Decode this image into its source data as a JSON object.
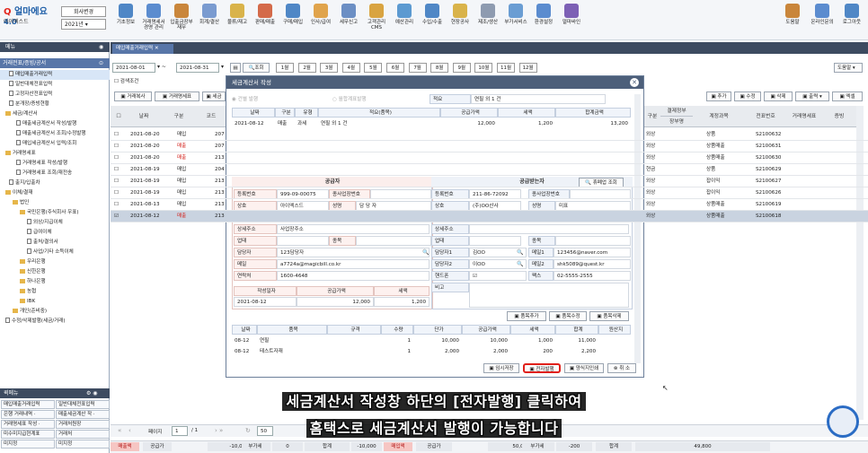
{
  "app": {
    "logo_prefix": "얼마에요",
    "logo_version": "4.0",
    "company": "아이엑스드",
    "company_btn": "회사변경",
    "year": "2021년"
  },
  "toolbar": {
    "left": [
      "기초정보",
      "거래명세서 경영 관리",
      "입출금장부 재무",
      "회계/결산",
      "물류/재고",
      "판매/매출",
      "구매/매입",
      "인사/급여",
      "세무신고",
      "고객관리 CMS",
      "예산관리",
      "수입/수출",
      "현장공사",
      "제조/생산",
      "부가서비스",
      "환경설정",
      "얼마바인"
    ],
    "right": [
      "도움말",
      "온라인문의",
      "로그아웃"
    ],
    "colors": [
      "#4f87c6",
      "#5b8ccf",
      "#c9863b",
      "#7a9bd0",
      "#d9b34a",
      "#d46a4a",
      "#4f87c6",
      "#e0a44c",
      "#6c8fc4",
      "#d9a441",
      "#5c9ad1",
      "#4f87c6",
      "#d9b34a",
      "#8e9bb0",
      "#6a9dd3",
      "#5b8ccf",
      "#7d60b5"
    ]
  },
  "left_panel": {
    "header": "메뉴",
    "subheader": "거래전표/증빙/공서",
    "tree": [
      {
        "label": "매입매출거래입력",
        "type": "doc",
        "indent": 2
      },
      {
        "label": "일반대체전표입력",
        "type": "doc",
        "indent": 2
      },
      {
        "label": "고정자산전표입력",
        "type": "doc",
        "indent": 2
      },
      {
        "label": "분개장/증빙현황",
        "type": "doc",
        "indent": 2
      },
      {
        "label": "세금/계산서",
        "type": "folder",
        "indent": 1
      },
      {
        "label": "매출세금계산서 작성/발행",
        "type": "doc",
        "indent": 4
      },
      {
        "label": "매출세금계산서 조회/수정발행",
        "type": "doc",
        "indent": 4
      },
      {
        "label": "매입세금계산서 입력/조회",
        "type": "doc",
        "indent": 4
      },
      {
        "label": "거래명세표",
        "type": "folder",
        "indent": 1
      },
      {
        "label": "거래명세표 작성/발행",
        "type": "doc",
        "indent": 4
      },
      {
        "label": "거래명세표 조회/재전송",
        "type": "doc",
        "indent": 4
      },
      {
        "label": "출지/입출차",
        "type": "doc",
        "indent": 2
      },
      {
        "label": "이체/결재",
        "type": "folder",
        "indent": 1
      },
      {
        "label": "법인",
        "type": "folder",
        "indent": 3
      },
      {
        "label": "국민은행(주식회사 우표)",
        "type": "folder",
        "indent": 5
      },
      {
        "label": "외상/지급이체",
        "type": "doc",
        "indent": 7
      },
      {
        "label": "급여이체",
        "type": "doc",
        "indent": 7
      },
      {
        "label": "출처/결의서",
        "type": "doc",
        "indent": 7
      },
      {
        "label": "사업/기타 소득이체",
        "type": "doc",
        "indent": 7
      },
      {
        "label": "우리은행",
        "type": "folder",
        "indent": 5
      },
      {
        "label": "신한은행",
        "type": "folder",
        "indent": 5
      },
      {
        "label": "하나은행",
        "type": "folder",
        "indent": 5
      },
      {
        "label": "농협",
        "type": "folder",
        "indent": 5
      },
      {
        "label": "IBK",
        "type": "folder",
        "indent": 5
      },
      {
        "label": "개인(준비중)",
        "type": "folder",
        "indent": 3
      },
      {
        "label": "수정/삭제발행(세금/거래)",
        "type": "doc",
        "indent": 1
      }
    ],
    "quick_header": "퀵메뉴",
    "quick": [
      "매입매출거래입력",
      "일반대체전표입력",
      "은행 거래내역 ·",
      "매출세금계산 작 ·",
      "거래명세표 작성 ·",
      "거래처원장",
      "미수미지급현계표",
      "거래처",
      "미지정",
      "미지정"
    ]
  },
  "main": {
    "tab": "매입매출거래입력",
    "date_from": "2021-08-01",
    "date_to": "2021-08-31",
    "search_btn": "조회",
    "months": [
      "1월",
      "2월",
      "3월",
      "4월",
      "5월",
      "6월",
      "7월",
      "8월",
      "9월",
      "10월",
      "11월",
      "12월"
    ],
    "search_cond": "검색조건",
    "help_select": "도움말",
    "action_left": [
      "거래복사",
      "거래명세표",
      "세금"
    ],
    "action_right": [
      "추가",
      "수정",
      "삭제",
      "출력",
      "엑셀"
    ],
    "headers_left": [
      "날짜",
      "구분",
      "코드"
    ],
    "headers_right": [
      "구분",
      "결제정부",
      "장부명",
      "계정과목",
      "전표번호",
      "거래명세표",
      "증빙"
    ],
    "rows": [
      {
        "date": "2021-08-20",
        "type": "매입",
        "code": "207",
        "pay": "외상",
        "acct": "상품",
        "no": "S2100632"
      },
      {
        "date": "2021-08-20",
        "type": "매출",
        "code": "207",
        "pay": "외상",
        "acct": "상품매출",
        "no": "S2100631"
      },
      {
        "date": "2021-08-20",
        "type": "매출",
        "code": "213",
        "pay": "외상",
        "acct": "상품매출",
        "no": "S2100630"
      },
      {
        "date": "2021-08-19",
        "type": "매입",
        "code": "204",
        "pay": "현금",
        "acct": "상품",
        "no": "S2100629"
      },
      {
        "date": "2021-08-19",
        "type": "매입",
        "code": "213",
        "pay": "외상",
        "acct": "잡이익",
        "no": "S2100627"
      },
      {
        "date": "2021-08-19",
        "type": "매입",
        "code": "213",
        "pay": "외상",
        "acct": "잡이익",
        "no": "S2100626"
      },
      {
        "date": "2021-08-13",
        "type": "매입",
        "code": "213",
        "pay": "외상",
        "acct": "상품매출",
        "no": "S2100619"
      },
      {
        "date": "2021-08-12",
        "type": "매출",
        "code": "213",
        "pay": "외상",
        "acct": "상품매출",
        "no": "S2100618"
      }
    ],
    "pager": {
      "page_label": "페이지",
      "page": "1",
      "of": "/ 1",
      "size": "50"
    },
    "totals": [
      {
        "label": "매출액",
        "red": true
      },
      {
        "label": "공급가",
        "red": false
      },
      {
        "label": "-10,000",
        "red": false
      },
      {
        "label": "부가세",
        "red": false
      },
      {
        "label": "0",
        "red": false
      },
      {
        "label": "합계",
        "red": false
      },
      {
        "label": "-10,000",
        "red": false
      },
      {
        "label": "매입액",
        "red": true
      },
      {
        "label": "공급가",
        "red": false
      },
      {
        "label": "50,000",
        "red": false
      },
      {
        "label": "부가세",
        "red": false
      },
      {
        "label": "-200",
        "red": false
      },
      {
        "label": "합계",
        "red": false
      },
      {
        "label": "49,800",
        "red": false
      }
    ]
  },
  "modal": {
    "title": "세금계산서 작성",
    "radio1": "건별 발행",
    "radio2": "월합계표발행",
    "memo_label": "적요",
    "memo_value": "연필 외 1 건",
    "top_headers": [
      "날짜",
      "구분",
      "유형",
      "적요(품목)",
      "공급가액",
      "세액",
      "합계금액"
    ],
    "top_row": [
      "2021-08-12",
      "매출",
      "과세",
      "연필 외 1 건",
      "12,000",
      "1,200",
      "13,200"
    ],
    "supplier_title": "공급자",
    "buyer_title": "공급받는자",
    "buyer_search": "휴폐업 조회",
    "supplier": {
      "reg_label": "등록번호",
      "reg": "999-09-00075",
      "sub_label": "종사업장번호",
      "sub": "",
      "name_label": "상호",
      "name": "아이엑스드",
      "ceo_label": "성명",
      "ceo": "담 당 자",
      "addr_label": "주소",
      "addr": "서울특별시 구로구 디지털로34길 55 (구로동)",
      "addr2_label": "상세주소",
      "addr2": "사업장주소",
      "biz_label": "업태",
      "biz": "",
      "item_label": "종목",
      "item": "",
      "mgr_label": "담당자",
      "mgr": "123담당자",
      "mail_label": "메일",
      "mail": "a7724a@magicbill.co.kr",
      "tel_label": "연락처",
      "tel": "1600-4648",
      "wdate_label": "작성일자",
      "wdate": "2021-08-12",
      "amt_label": "공급가액",
      "amt": "12,000",
      "tax_label": "세액",
      "tax": "1,200"
    },
    "buyer": {
      "reg_label": "등록번호",
      "reg": "211-86-72092",
      "sub_label": "종사업장번호",
      "sub": "",
      "name_label": "상호",
      "name": "(주)OO산사",
      "ceo_label": "성명",
      "ceo": "미표",
      "addr_label": "주소",
      "addr": "서울시 구로구 구로동",
      "addr2_label": "상세주소",
      "addr2": "",
      "biz_label": "업태",
      "biz": "",
      "item_label": "종목",
      "item": "",
      "mgr1_label": "담당자1",
      "mgr1": "김OO",
      "mail1_label": "메일1",
      "mail1": "123456@naver.com",
      "mgr2_label": "담당자2",
      "mgr2": "이OO",
      "mail2_label": "메일2",
      "mail2": "shk5089@quest.kr",
      "phone_label": "핸드폰",
      "fax_label": "팩스",
      "fax": "02-5555-2555",
      "note_label": "비고"
    },
    "item_buttons": [
      "품목추가",
      "품목수정",
      "품목삭제"
    ],
    "item_headers": [
      "날짜",
      "품목",
      "규격",
      "수량",
      "단가",
      "공급가액",
      "세액",
      "합계",
      "원산지"
    ],
    "items": [
      [
        "08-12",
        "연필",
        "",
        "1",
        "10,000",
        "10,000",
        "1,000",
        "11,000",
        ""
      ],
      [
        "08-12",
        "테스트자재",
        "",
        "1",
        "2,000",
        "2,000",
        "200",
        "2,200",
        ""
      ]
    ],
    "footer_buttons": [
      "임시저장",
      "전자발행",
      "양식지인쇄",
      "취 소"
    ]
  },
  "caption": {
    "line1": "세금계산서 작성창 하단의 [전자발행] 클릭하여",
    "line2": "홈택스로 세금계산서 발행이 가능합니다"
  }
}
